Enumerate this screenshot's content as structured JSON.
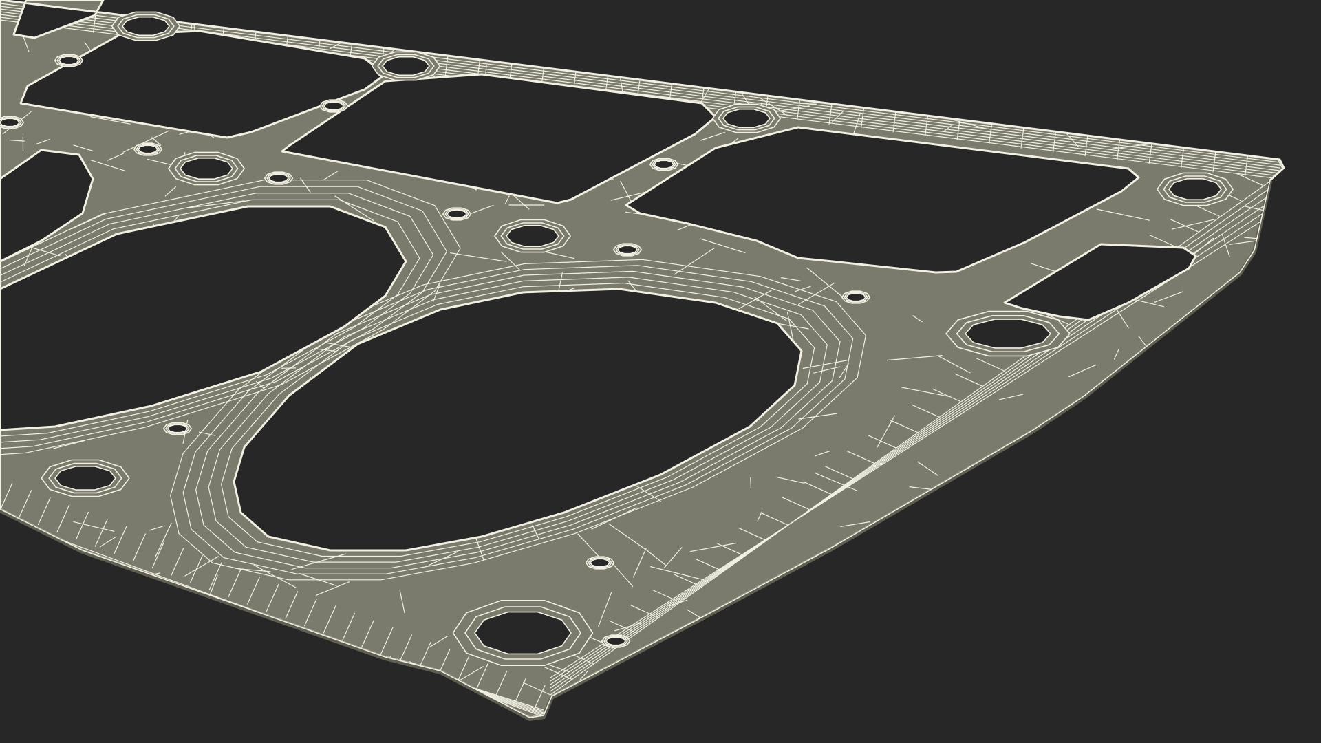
{
  "scene": {
    "subject": "gasket-wireframe",
    "colors": {
      "background": "#272727",
      "surface": "#7b7b6d",
      "wire": "#f2f0e2",
      "edge": "#5e5e52"
    }
  }
}
